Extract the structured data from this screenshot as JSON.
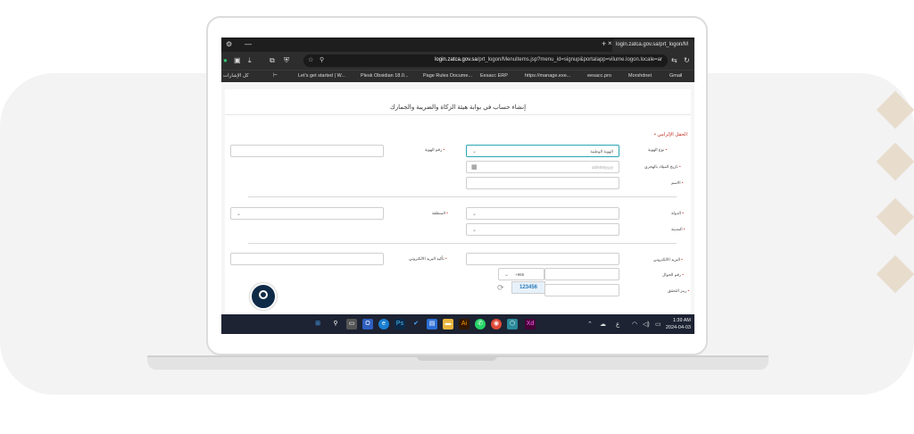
{
  "browser": {
    "tab_title": "login.zatca.gov.sa/prt_logon/M",
    "new_tab": "+",
    "tab_close": "×",
    "url_domain": "login.zatca.gov.sa",
    "url_path": "/prt_logon/MenuItems.jsp?menu_id=signup&portalapp=vilume.logon.locale=ar",
    "bookmarks": [
      "كل الإشارات",
      "Let's get started | W...",
      "Plesk Obsidian 18.0...",
      "Page Rules Docume...",
      "Eesacc ERP",
      "https://manage.exe...",
      "eesacc.pro",
      "Morshdnet",
      "Gmail"
    ]
  },
  "form": {
    "title": "إنشاء حساب في بوابة هيئة الزكاة والضريبة والجمارك",
    "section_header": "• الحقل الإلزامي",
    "id_type_label": "نوع الهوية",
    "id_type_value": "الهوية الوطنية",
    "id_number_label": "رقم الهوية",
    "dob_label": "تاريخ الميلاد بالهجري",
    "dob_placeholder": "dd/MM/yyyy",
    "name_label": "الاسم",
    "country_label": "الدولة",
    "region_label": "المنطقة",
    "city_label": "المدينة",
    "email_label": "البريد الالكتروني",
    "email_confirm_label": "تأكيد البريد الالكتروني",
    "mobile_label": "رقم الجوال",
    "mobile_code": "+966",
    "captcha_label": "رمز التحقق",
    "captcha_value": "123456",
    "req": "•"
  },
  "taskbar": {
    "time": "1:39 AM",
    "date": "2024-04-03"
  },
  "colors": {
    "accent": "#2aa6b4",
    "required": "#c0392b",
    "taskbar": "#1d2333"
  }
}
